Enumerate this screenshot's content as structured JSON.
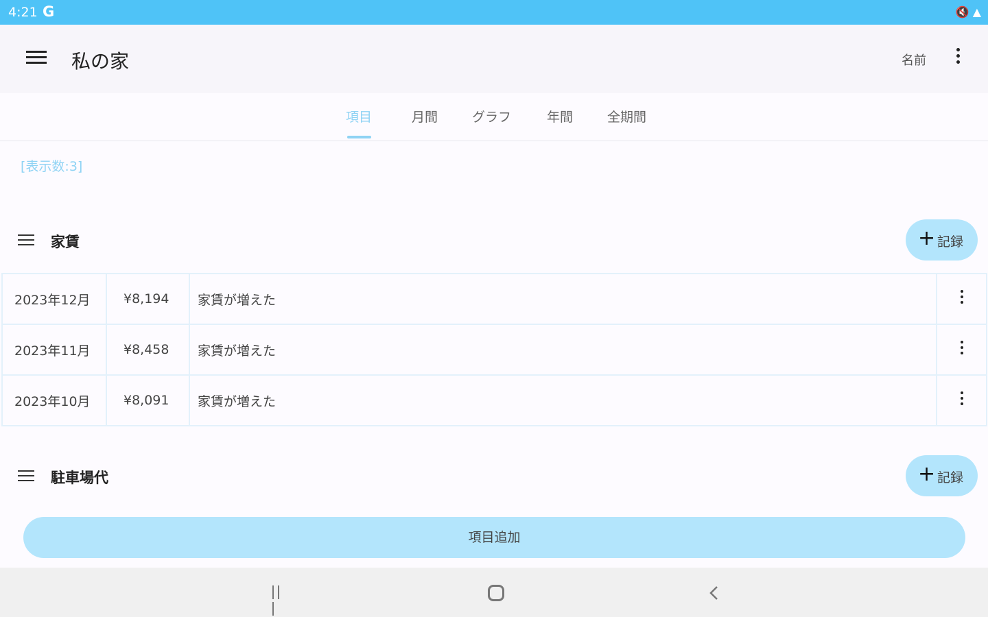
{
  "status_bar": {
    "time": "4:21",
    "carrier_icon": "G",
    "right_icons": "🔇 ▲"
  },
  "app_bar": {
    "title": "私の家",
    "name_button": "名前"
  },
  "tabs": [
    {
      "label": "項目",
      "active": true
    },
    {
      "label": "月間",
      "active": false
    },
    {
      "label": "グラフ",
      "active": false
    },
    {
      "label": "年間",
      "active": false
    },
    {
      "label": "全期間",
      "active": false
    }
  ],
  "count_label": "[表示数:3]",
  "categories": [
    {
      "name": "家賃",
      "record_label": "記録",
      "rows": [
        {
          "date": "2023年12月",
          "amount": "¥8,194",
          "memo": "家賃が増えた"
        },
        {
          "date": "2023年11月",
          "amount": "¥8,458",
          "memo": "家賃が増えた"
        },
        {
          "date": "2023年10月",
          "amount": "¥8,091",
          "memo": "家賃が増えた"
        }
      ]
    },
    {
      "name": "駐車場代",
      "record_label": "記録",
      "rows": []
    }
  ],
  "add_item_button": "項目追加",
  "colors": {
    "status_bar": "#4fc3f7",
    "accent": "#8fd3f4",
    "button_bg": "#b3e5fc"
  }
}
